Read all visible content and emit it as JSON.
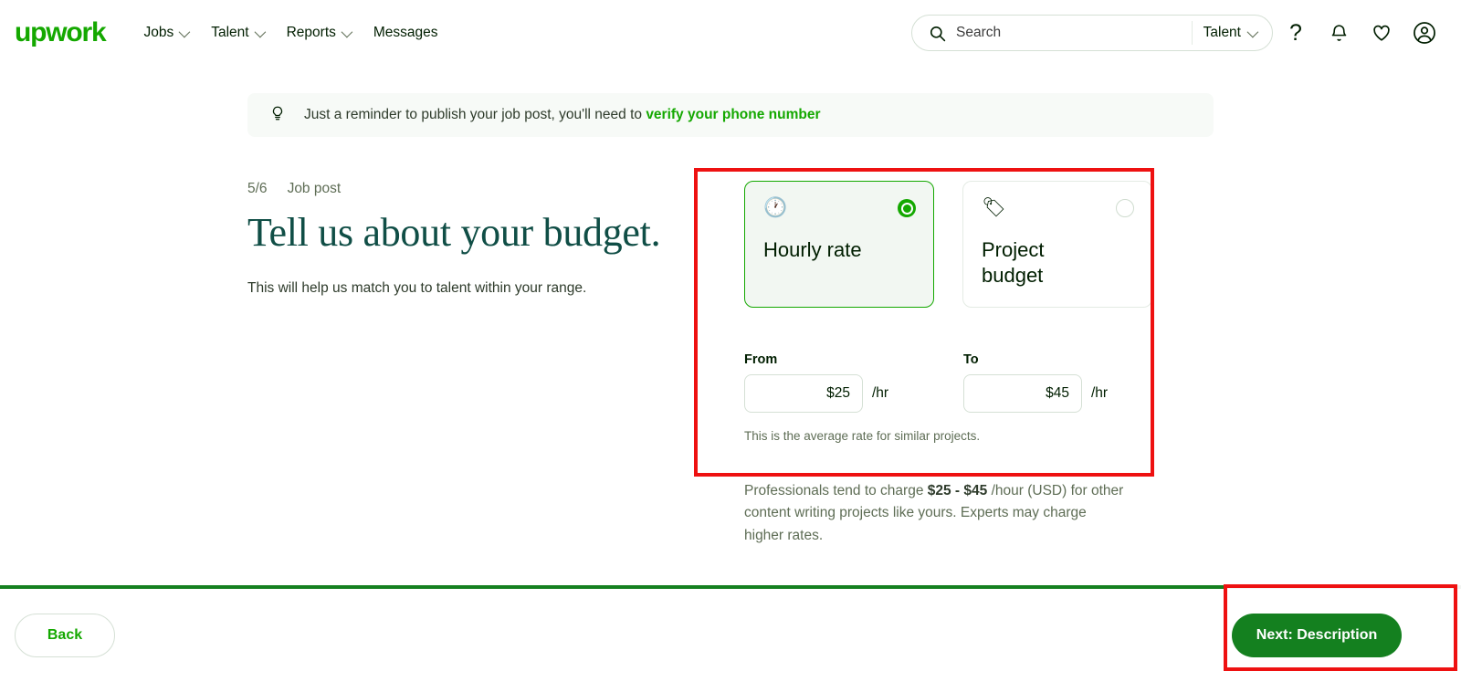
{
  "header": {
    "logo_text": "upwork",
    "nav": [
      {
        "label": "Jobs",
        "has_caret": true
      },
      {
        "label": "Talent",
        "has_caret": true
      },
      {
        "label": "Reports",
        "has_caret": true
      },
      {
        "label": "Messages",
        "has_caret": false
      }
    ],
    "search": {
      "placeholder": "Search",
      "value": "",
      "icon": "search-icon",
      "scope_label": "Talent",
      "scope_caret": "chevron-down-icon"
    },
    "icons": [
      {
        "name": "help-icon",
        "glyph": "?"
      },
      {
        "name": "notifications-bell-icon",
        "glyph": "bell"
      },
      {
        "name": "favorites-heart-icon",
        "glyph": "heart"
      },
      {
        "name": "user-avatar-icon",
        "glyph": "user-circle"
      }
    ]
  },
  "banner": {
    "icon": "lightbulb-icon",
    "text": "Just a reminder to publish your job post, you'll need to ",
    "link_text": "verify your phone number"
  },
  "main": {
    "step_counter": "5/6",
    "step_name": "Job post",
    "title": "Tell us about your budget.",
    "subtitle": "This will help us match you to talent within your range."
  },
  "budget": {
    "options": [
      {
        "id": "hourly-rate",
        "label": "Hourly rate",
        "emoji": "🕐",
        "icon_name": "clock-icon",
        "selected": true
      },
      {
        "id": "project-budget",
        "label": "Project budget",
        "emoji": "🏷",
        "icon_name": "price-tag-icon",
        "selected": false
      }
    ],
    "from": {
      "label": "From",
      "value": "$25",
      "placeholder": "$0.00",
      "unit": "/hr"
    },
    "to": {
      "label": "To",
      "value": "$45",
      "placeholder": "$0.00",
      "unit": "/hr"
    },
    "helper_text": "This is the average rate for similar projects.",
    "note_prefix": "Professionals tend to charge ",
    "note_range": "$25 - $45",
    "note_suffix": " /hour (USD) for other content writing projects like yours. Experts may charge higher rates."
  },
  "footer": {
    "back_label": "Back",
    "next_label": "Next: Description",
    "progress_percent": 83
  },
  "colors": {
    "brand_green": "#14a800",
    "button_green": "#14801f",
    "title_teal": "#104e46",
    "annotation_red": "#ee1111",
    "selected_card_bg": "#f2f7f2",
    "banner_bg": "#f7faf7"
  },
  "annotations": [
    {
      "name": "budget-section-highlight",
      "color": "#ee1111"
    },
    {
      "name": "next-button-highlight",
      "color": "#ee1111"
    }
  ]
}
